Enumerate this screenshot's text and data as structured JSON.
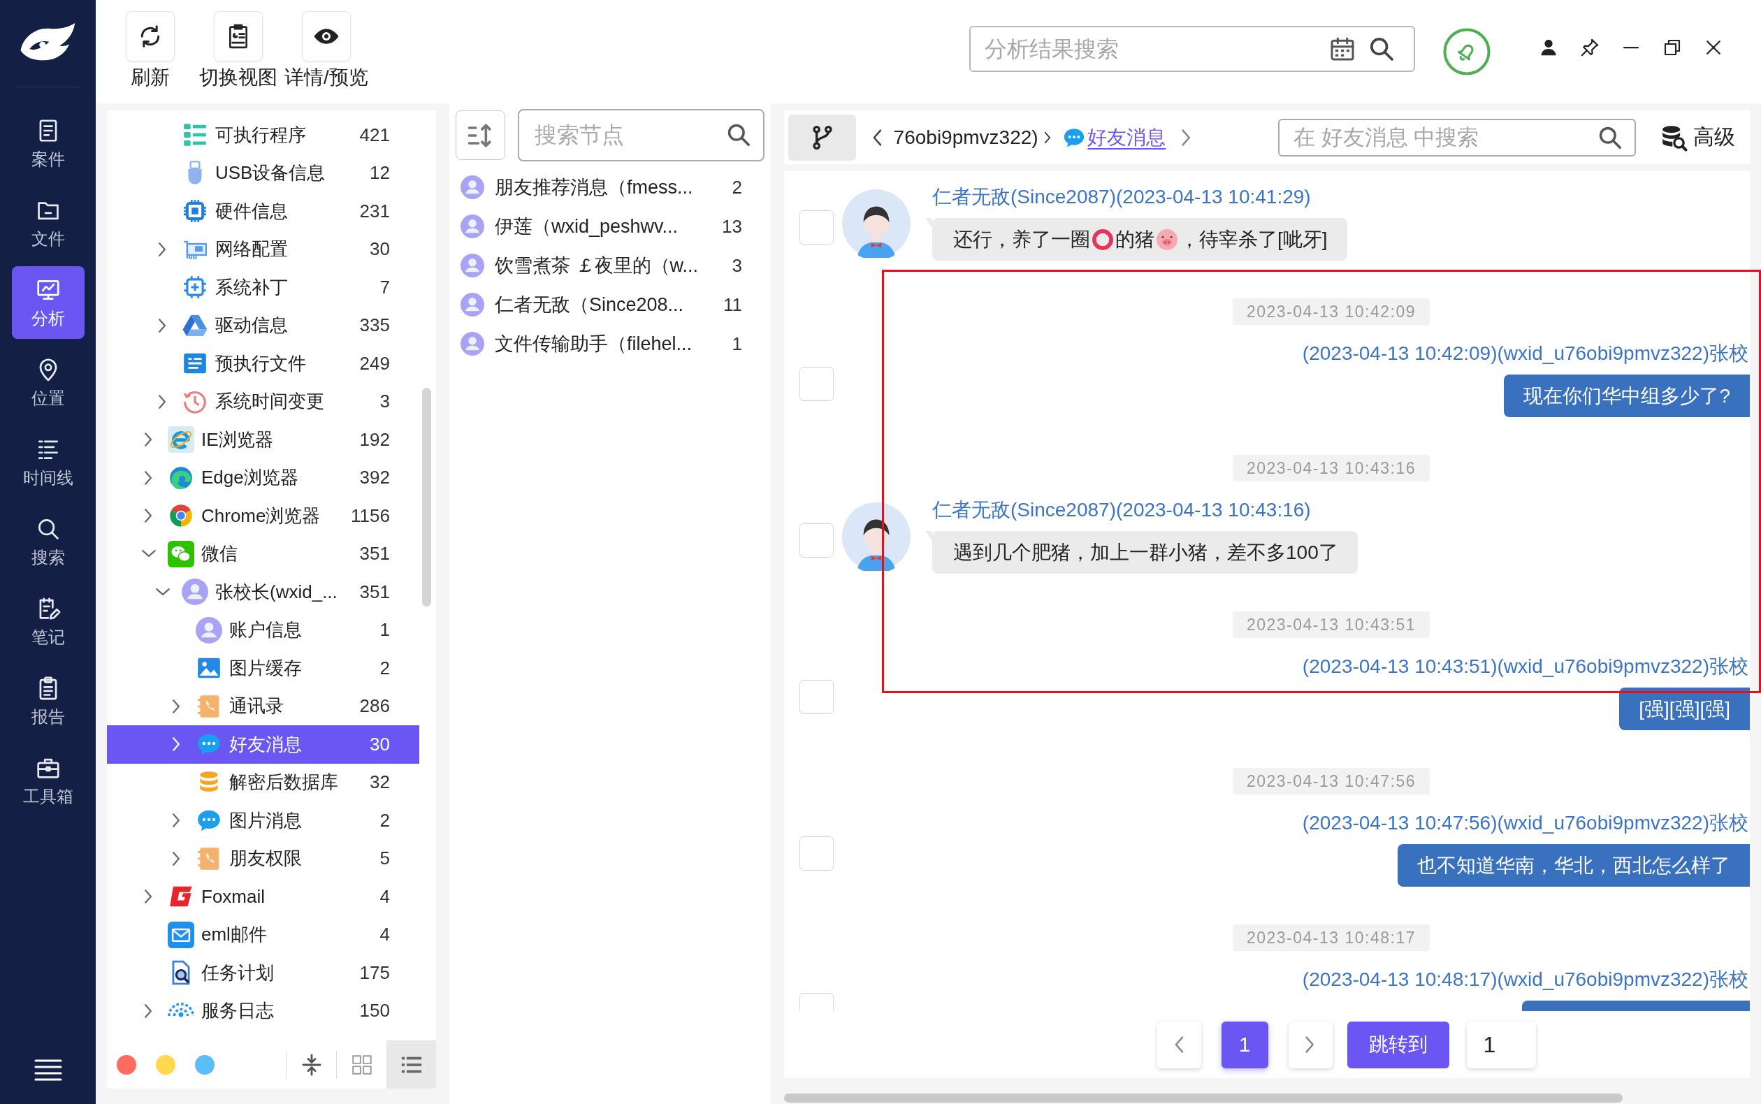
{
  "nav": {
    "items": [
      {
        "kind": "case",
        "label": "案件",
        "selected": false
      },
      {
        "kind": "file",
        "label": "文件",
        "selected": false
      },
      {
        "kind": "analysis",
        "label": "分析",
        "selected": true
      },
      {
        "kind": "location",
        "label": "位置",
        "selected": false
      },
      {
        "kind": "timeline",
        "label": "时间线",
        "selected": false
      },
      {
        "kind": "search",
        "label": "搜索",
        "selected": false
      },
      {
        "kind": "notes",
        "label": "笔记",
        "selected": false
      },
      {
        "kind": "report",
        "label": "报告",
        "selected": false
      },
      {
        "kind": "toolbox",
        "label": "工具箱",
        "selected": false
      }
    ]
  },
  "toolbar": {
    "buttons": [
      {
        "kind": "refresh",
        "label": "刷新"
      },
      {
        "kind": "switch_view",
        "label": "切换视图"
      },
      {
        "kind": "preview",
        "label": "详情/预览"
      }
    ],
    "search": {
      "placeholder": "分析结果搜索"
    }
  },
  "tree": {
    "items": [
      {
        "children": [
          {
            "kind": "program",
            "label": "可执行程序",
            "count": "421",
            "selected": false
          },
          {
            "kind": "usb",
            "label": "USB设备信息",
            "count": "12",
            "selected": false
          },
          {
            "kind": "chip",
            "label": "硬件信息",
            "count": "231",
            "selected": false
          },
          {
            "kind": "network",
            "label": "网络配置",
            "count": "30",
            "expanded": false,
            "selected": false
          },
          {
            "kind": "patch",
            "label": "系统补丁",
            "count": "7",
            "selected": false
          },
          {
            "kind": "driver",
            "label": "驱动信息",
            "count": "335",
            "expanded": false,
            "selected": false
          },
          {
            "kind": "prefetch",
            "label": "预执行文件",
            "count": "249",
            "selected": false
          },
          {
            "kind": "clock",
            "label": "系统时间变更",
            "count": "3",
            "expanded": false,
            "selected": false
          }
        ]
      },
      {
        "kind": "ie",
        "label": "IE浏览器",
        "count": "192",
        "expanded": false,
        "selected": false
      },
      {
        "kind": "edge",
        "label": "Edge浏览器",
        "count": "392",
        "expanded": false,
        "selected": false
      },
      {
        "kind": "chrome",
        "label": "Chrome浏览器",
        "count": "1156",
        "expanded": false,
        "selected": false
      },
      {
        "kind": "wechat",
        "label": "微信",
        "count": "351",
        "expanded": true,
        "selected": false,
        "children": [
          {
            "kind": "account",
            "label": "张校长(wxid_...",
            "count": "351",
            "expanded": true,
            "selected": false,
            "children": [
              {
                "kind": "account",
                "label": "账户信息",
                "count": "1",
                "selected": false
              },
              {
                "kind": "picture",
                "label": "图片缓存",
                "count": "2",
                "selected": false
              },
              {
                "kind": "contacts",
                "label": "通讯录",
                "count": "286",
                "expanded": false,
                "selected": false
              },
              {
                "kind": "chat",
                "label": "好友消息",
                "count": "30",
                "expanded": false,
                "selected": true
              },
              {
                "kind": "database",
                "label": "解密后数据库",
                "count": "32",
                "selected": false
              },
              {
                "kind": "chat",
                "label": "图片消息",
                "count": "2",
                "expanded": false,
                "selected": false
              },
              {
                "kind": "contacts",
                "label": "朋友权限",
                "count": "5",
                "expanded": false,
                "selected": false
              }
            ]
          }
        ]
      },
      {
        "kind": "foxmail",
        "label": "Foxmail",
        "count": "4",
        "expanded": false,
        "selected": false
      },
      {
        "kind": "mail",
        "label": "eml邮件",
        "count": "4",
        "selected": false
      },
      {
        "kind": "task",
        "label": "任务计划",
        "count": "175",
        "selected": false
      },
      {
        "kind": "service",
        "label": "服务日志",
        "count": "150",
        "expanded": false,
        "selected": false
      }
    ],
    "color_filters": [
      {
        "color": "#ff6b5e"
      },
      {
        "color": "#ffd84f"
      },
      {
        "color": "#5bbef8"
      }
    ],
    "views": [
      {
        "kind": "grid",
        "selected": false
      },
      {
        "kind": "list",
        "selected": true
      }
    ]
  },
  "node_list": {
    "search": {
      "placeholder": "搜索节点"
    },
    "items": [
      {
        "label": "朋友推荐消息（fmess...",
        "count": "2",
        "selected": false
      },
      {
        "label": "伊莲（wxid_peshwv...",
        "count": "13",
        "selected": false
      },
      {
        "label": "饮雪煮茶 ￡夜里的（w...",
        "count": "3",
        "selected": false
      },
      {
        "label": "仁者无敌（Since208...",
        "count": "11",
        "selected": false
      },
      {
        "label": "文件传输助手（filehel...",
        "count": "1",
        "selected": false
      }
    ]
  },
  "chat": {
    "breadcrumb": [
      {
        "kind": "text",
        "label": "76obi9pmvz322)",
        "selected": false
      },
      {
        "kind": "chat",
        "label": "好友消息",
        "selected": true
      }
    ],
    "search": {
      "placeholder": "在 好友消息 中搜索"
    },
    "advanced_button": {
      "label": "高级"
    },
    "messages": [
      {
        "kind": "incoming",
        "sender": "仁者无敌(Since2087)(2023-04-13 10:41:29)",
        "checked": false,
        "content": [
          {
            "kind": "text",
            "text": "还行，养了一圈"
          },
          {
            "kind": "ring"
          },
          {
            "kind": "text",
            "text": "的猪"
          },
          {
            "kind": "pig"
          },
          {
            "kind": "text",
            "text": "，待宰杀了[呲牙]"
          }
        ]
      },
      {
        "kind": "outgoing",
        "time": "2023-04-13 10:42:09",
        "sender": "(2023-04-13 10:42:09)(wxid_u76obi9pmvz322)张校",
        "checked": false,
        "content": [
          {
            "kind": "text",
            "text": "现在你们华中组多少了?"
          }
        ]
      },
      {
        "kind": "incoming",
        "time": "2023-04-13 10:43:16",
        "sender": "仁者无敌(Since2087)(2023-04-13 10:43:16)",
        "checked": false,
        "content": [
          {
            "kind": "text",
            "text": "遇到几个肥猪，加上一群小猪，差不多100了"
          }
        ]
      },
      {
        "kind": "outgoing",
        "time": "2023-04-13 10:43:51",
        "sender": "(2023-04-13 10:43:51)(wxid_u76obi9pmvz322)张校",
        "checked": false,
        "content": [
          {
            "kind": "text",
            "text": "[强][强][强]"
          }
        ]
      },
      {
        "kind": "outgoing",
        "time": "2023-04-13 10:47:56",
        "sender": "(2023-04-13 10:47:56)(wxid_u76obi9pmvz322)张校",
        "checked": false,
        "content": [
          {
            "kind": "text",
            "text": "也不知道华南，华北，西北怎么样了"
          }
        ]
      },
      {
        "kind": "outgoing",
        "time": "2023-04-13 10:48:17",
        "sender": "(2023-04-13 10:48:17)(wxid_u76obi9pmvz322)张校",
        "checked": false
      }
    ],
    "pagination": {
      "pages": [
        {
          "label": "1",
          "selected": true
        }
      ],
      "jump_button": {
        "label": "跳转到"
      },
      "jump_input": {
        "value": "1"
      }
    }
  }
}
